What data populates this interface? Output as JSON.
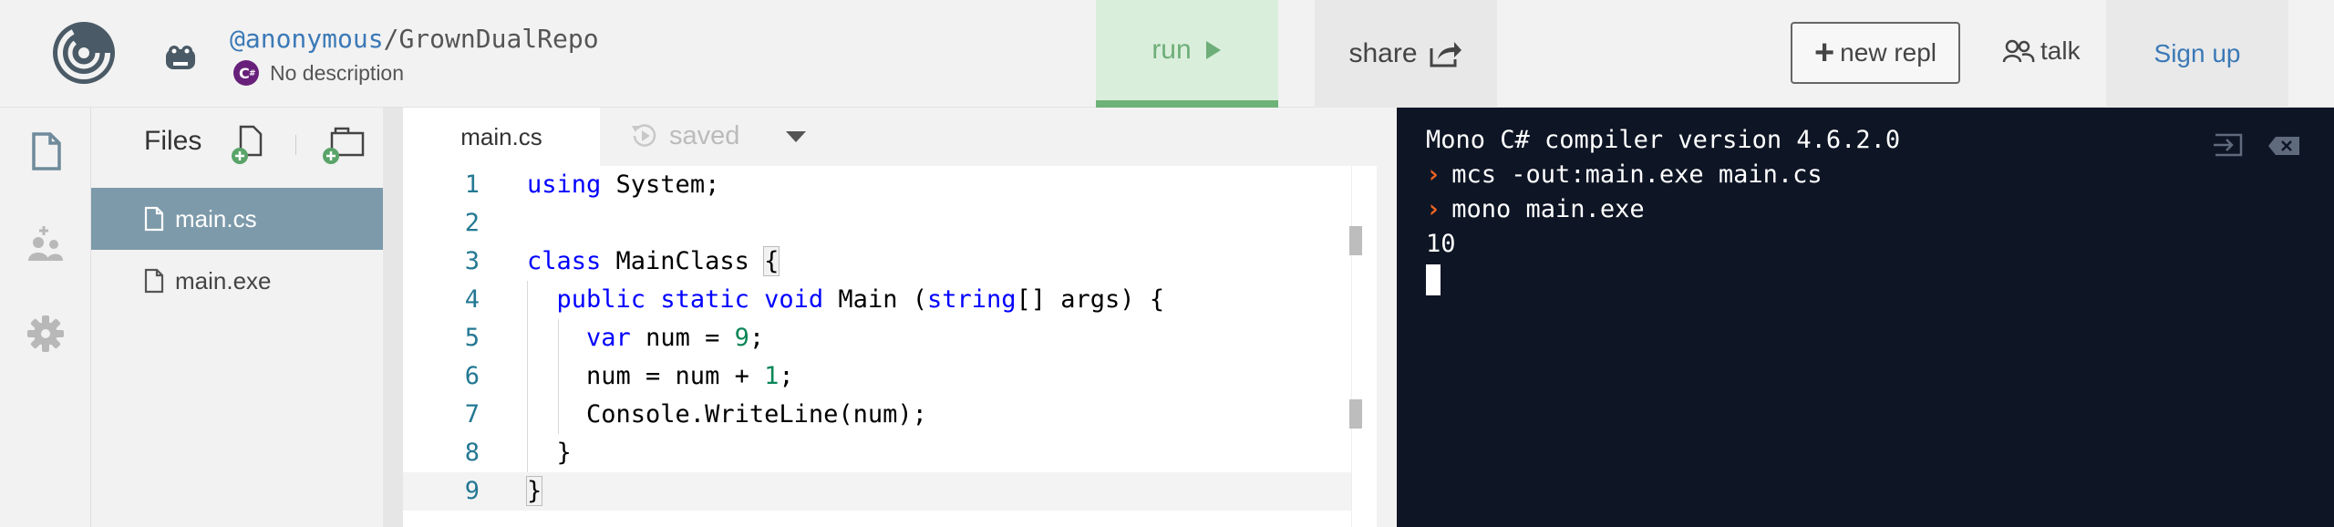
{
  "header": {
    "username": "@anonymous",
    "separator": "/",
    "repo_name": "GrownDualRepo",
    "description": "No description",
    "run_label": "run",
    "share_label": "share",
    "new_repl_label": "new repl",
    "talk_label": "talk",
    "signup_label": "Sign up"
  },
  "files": {
    "title": "Files",
    "items": [
      {
        "name": "main.cs",
        "active": true
      },
      {
        "name": "main.exe",
        "active": false
      }
    ]
  },
  "editor": {
    "tab_label": "main.cs",
    "saved_label": "saved",
    "lines": [
      {
        "n": "1",
        "html": "<span class=\"kw\">using</span> System;"
      },
      {
        "n": "2",
        "html": ""
      },
      {
        "n": "3",
        "html": "<span class=\"kw\">class</span> MainClass <span class=\"bracket-box\">{</span>"
      },
      {
        "n": "4",
        "html": "  <span class=\"kw\">public</span> <span class=\"kw\">static</span> <span class=\"kw\">void</span> Main (<span class=\"kw\">string</span>[] args) {"
      },
      {
        "n": "5",
        "html": "    <span class=\"kw\">var</span> num = <span class=\"num\">9</span>;"
      },
      {
        "n": "6",
        "html": "    num = num + <span class=\"num\">1</span>;"
      },
      {
        "n": "7",
        "html": "    Console.WriteLine(num);"
      },
      {
        "n": "8",
        "html": "  }"
      },
      {
        "n": "9",
        "html": "<span class=\"bracket-box\">}</span>"
      }
    ],
    "current_line": "9"
  },
  "console": {
    "lines": [
      {
        "prompt": false,
        "text": "Mono C# compiler version 4.6.2.0"
      },
      {
        "prompt": true,
        "text": "mcs -out:main.exe main.cs"
      },
      {
        "prompt": true,
        "text": "mono main.exe"
      },
      {
        "prompt": false,
        "text": "10"
      }
    ]
  },
  "colors": {
    "accent": "#3b79b7",
    "run_bg": "#d9eedb",
    "run_fg": "#6eae78",
    "console_bg": "#0e1525",
    "prompt": "#f26522",
    "active_file": "#7d9aaa"
  }
}
